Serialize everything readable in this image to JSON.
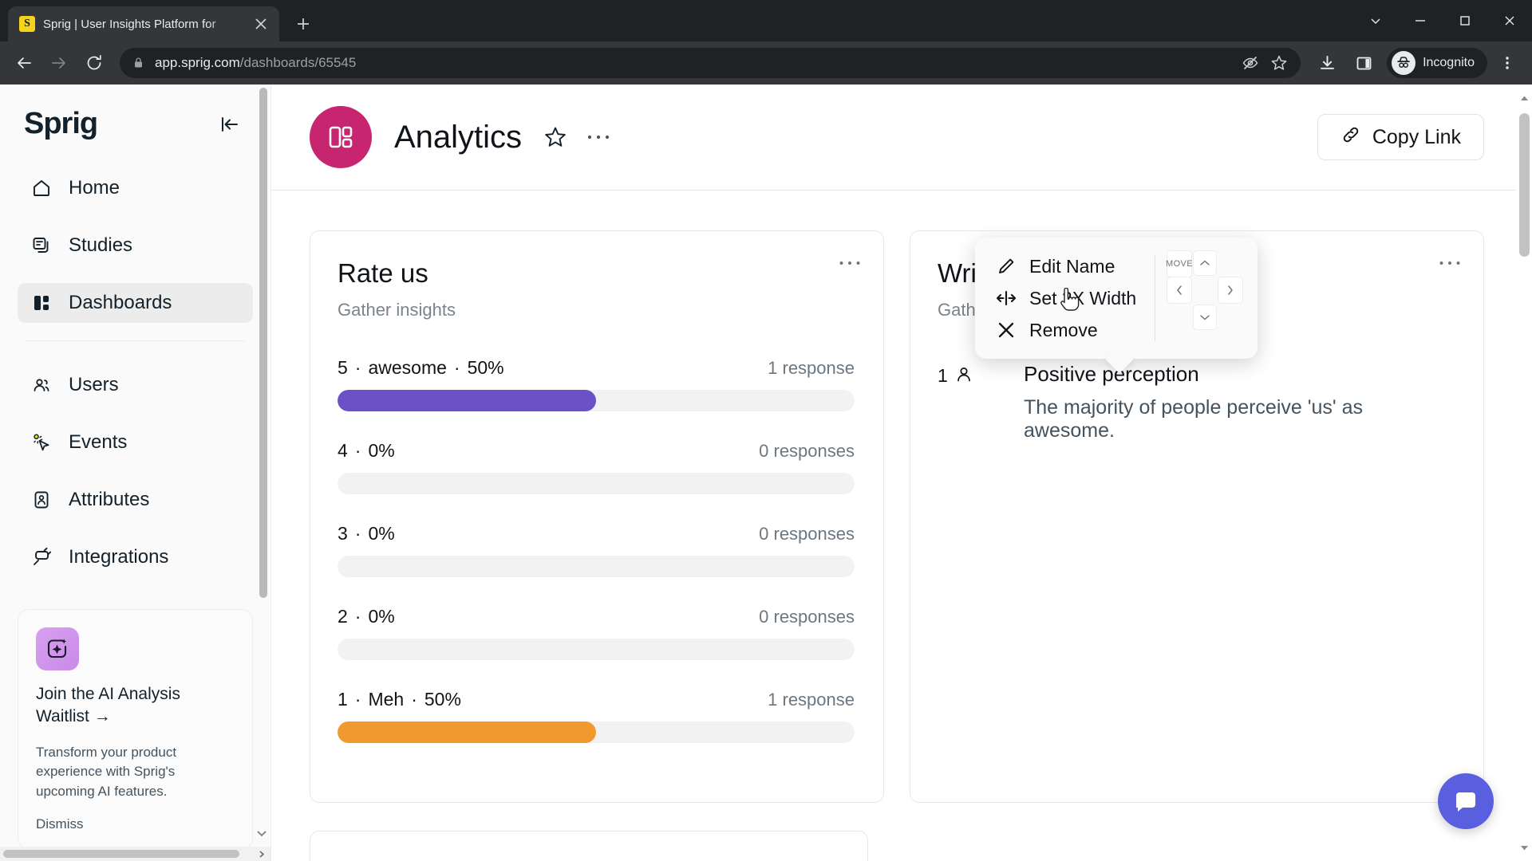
{
  "browser": {
    "tab": {
      "title": "Sprig | User Insights Platform for",
      "favicon_letter": "S",
      "favicon_name": "sprig-favicon"
    },
    "new_tab_label": "+",
    "url_host": "app.sprig.com",
    "url_path": "/dashboards/65545",
    "profile_label": "Incognito",
    "window_controls": {
      "minimize": "–",
      "maximize": "□",
      "close": "✕",
      "chevron": "⌄"
    }
  },
  "sidebar": {
    "logo": "Sprig",
    "collapse_tooltip": "Collapse",
    "items": [
      {
        "label": "Home",
        "icon": "home-icon",
        "active": false
      },
      {
        "label": "Studies",
        "icon": "studies-icon",
        "active": false
      },
      {
        "label": "Dashboards",
        "icon": "dashboards-icon",
        "active": true
      },
      {
        "label": "Users",
        "icon": "users-icon",
        "active": false
      },
      {
        "label": "Events",
        "icon": "events-icon",
        "active": false
      },
      {
        "label": "Attributes",
        "icon": "attributes-icon",
        "active": false
      },
      {
        "label": "Integrations",
        "icon": "integrations-icon",
        "active": false
      }
    ],
    "promo": {
      "icon": "ai-sparkle-icon",
      "title": "Join the AI Analysis Waitlist →",
      "body": "Transform your product experience with Sprig's upcoming AI features.",
      "dismiss": "Dismiss"
    }
  },
  "header": {
    "title": "Analytics",
    "avatar_icon": "dashboard-tile-icon",
    "star_icon": "star-icon",
    "more_icon": "ellipsis-icon",
    "copy_link_label": "Copy Link",
    "copy_link_icon": "link-icon"
  },
  "popup_menu": {
    "items": [
      {
        "label": "Edit Name",
        "icon": "pencil-icon"
      },
      {
        "label": "Set 2X Width",
        "icon": "arrows-horizontal-icon"
      },
      {
        "label": "Remove",
        "icon": "close-x-icon"
      }
    ],
    "move": {
      "label": "MOVE",
      "up": "⌃",
      "down": "⌄",
      "left": "‹",
      "right": "›"
    }
  },
  "cards": [
    {
      "title": "Rate us",
      "subtitle": "Gather insights",
      "more_icon": "ellipsis-icon",
      "type": "rating-bars"
    },
    {
      "title": "Write about us",
      "subtitle": "Gather insights",
      "more_icon": "ellipsis-icon",
      "type": "insight",
      "insight": {
        "count": "1",
        "count_icon": "person-icon",
        "title": "Positive perception",
        "text": "The majority of people perceive 'us' as awesome."
      }
    }
  ],
  "chart_data": {
    "type": "bar",
    "title": "Rate us",
    "subtitle": "Gather insights",
    "orientation": "horizontal",
    "grid": false,
    "legend": "none",
    "xlabel": "",
    "ylabel": "",
    "xlim": [
      0,
      100
    ],
    "categories": [
      "5",
      "4",
      "3",
      "2",
      "1"
    ],
    "rows": [
      {
        "score": "5",
        "label": "awesome",
        "percent_text": "50%",
        "value": 50,
        "responses_text": "1 response",
        "responses": 1,
        "color": "#6b51c8"
      },
      {
        "score": "4",
        "label": "",
        "percent_text": "0%",
        "value": 0,
        "responses_text": "0 responses",
        "responses": 0,
        "color": "#f2f2f2"
      },
      {
        "score": "3",
        "label": "",
        "percent_text": "0%",
        "value": 0,
        "responses_text": "0 responses",
        "responses": 0,
        "color": "#f2f2f2"
      },
      {
        "score": "2",
        "label": "",
        "percent_text": "0%",
        "value": 0,
        "responses_text": "0 responses",
        "responses": 0,
        "color": "#f2f2f2"
      },
      {
        "score": "1",
        "label": "Meh",
        "percent_text": "50%",
        "value": 50,
        "responses_text": "1 response",
        "responses": 1,
        "color": "#f0992e"
      }
    ],
    "separator": "·",
    "track_color": "#f2f2f2"
  },
  "colors": {
    "brand_magenta": "#c7256f",
    "bar_purple": "#6b51c8",
    "bar_orange": "#f0992e",
    "chat_blue": "#5a5fe0",
    "promo_purple": "#d29cf0"
  },
  "chat": {
    "icon": "chat-bubble-icon"
  }
}
